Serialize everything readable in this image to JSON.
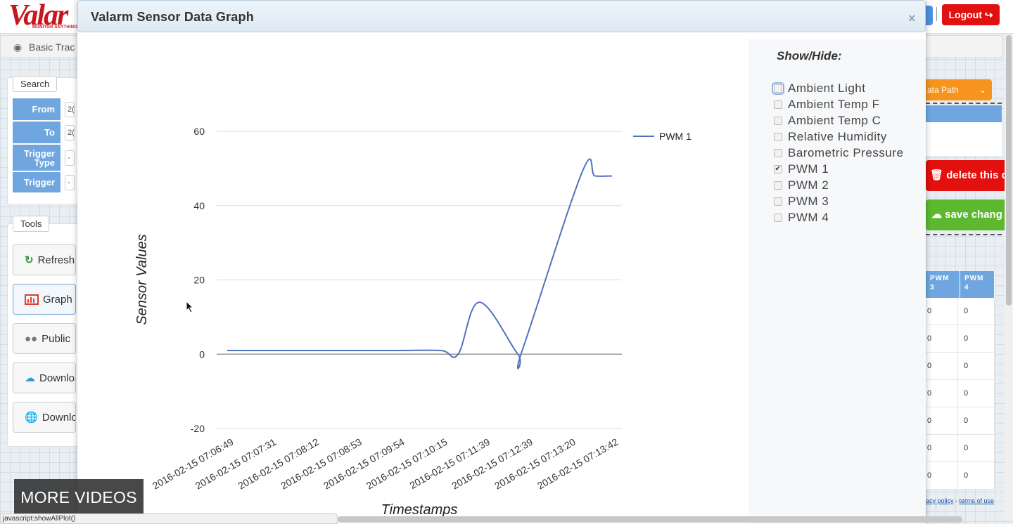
{
  "background": {
    "logo_text": "Valar",
    "logo_tagline": "MONITOR ANYTHING",
    "logout_label": "Logout",
    "breadcrumb": "Basic Trac",
    "search": {
      "legend": "Search",
      "rows": [
        {
          "label": "From",
          "value": "2("
        },
        {
          "label": "To",
          "value": "2("
        },
        {
          "label": "Trigger Type",
          "value": "-"
        },
        {
          "label": "Trigger",
          "value": "-"
        }
      ]
    },
    "tools": {
      "legend": "Tools",
      "buttons": [
        {
          "label": "Refresh",
          "icon": "refresh-icon"
        },
        {
          "label": "Graph",
          "icon": "bar-chart-icon"
        },
        {
          "label": "Public",
          "icon": "users-icon"
        },
        {
          "label": "Download",
          "icon": "cloud-download-icon"
        },
        {
          "label": "Download",
          "icon": "globe-icon"
        }
      ]
    },
    "right": {
      "data_path_label": "ata Path",
      "delete_label": "delete this de",
      "save_label": "save chang",
      "table": {
        "headers": [
          "PWM 3",
          "PWM 4"
        ],
        "rows": [
          [
            "0",
            "0"
          ],
          [
            "0",
            "0"
          ],
          [
            "0",
            "0"
          ],
          [
            "0",
            "0"
          ],
          [
            "0",
            "0"
          ],
          [
            "0",
            "0"
          ],
          [
            "0",
            "0"
          ]
        ]
      },
      "footer_privacy": "acy policy",
      "footer_sep": " - ",
      "footer_terms": "terms of use"
    }
  },
  "modal": {
    "title": "Valarm Sensor Data Graph",
    "close_label": "×",
    "show_hide": {
      "title": "Show/Hide:",
      "items": [
        {
          "label": "Ambient Light",
          "checked": false,
          "focused": true
        },
        {
          "label": "Ambient Temp F",
          "checked": false
        },
        {
          "label": "Ambient Temp C",
          "checked": false
        },
        {
          "label": "Relative Humidity",
          "checked": false
        },
        {
          "label": "Barometric Pressure",
          "checked": false
        },
        {
          "label": "PWM 1",
          "checked": true
        },
        {
          "label": "PWM 2",
          "checked": false
        },
        {
          "label": "PWM 3",
          "checked": false
        },
        {
          "label": "PWM 4",
          "checked": false
        }
      ]
    }
  },
  "chart_data": {
    "type": "line",
    "title": "",
    "xlabel": "Timestamps",
    "ylabel": "Sensor Values",
    "ylim": [
      -20,
      60
    ],
    "yticks": [
      -20,
      0,
      20,
      40,
      60
    ],
    "grid": true,
    "legend_position": "right",
    "x": [
      "2016-02-15 07:06:49",
      "2016-02-15 07:07:31",
      "2016-02-15 07:08:12",
      "2016-02-15 07:08:53",
      "2016-02-15 07:09:54",
      "2016-02-15 07:10:15",
      "2016-02-15 07:11:39",
      "2016-02-15 07:12:39",
      "2016-02-15 07:13:20",
      "2016-02-15 07:13:42"
    ],
    "series": [
      {
        "name": "PWM 1",
        "color": "#4f72c0",
        "values": [
          1,
          1,
          1,
          1,
          1,
          1,
          0,
          14,
          0,
          1,
          49,
          48,
          48
        ]
      }
    ],
    "series_x_positions": [
      0,
      1,
      2,
      3,
      4,
      5,
      5.4,
      5.9,
      6.8,
      6.9,
      8.3,
      8.6,
      9
    ]
  },
  "more_videos_label": "MORE VIDEOS",
  "status_text": "javascript:showAllPlot()"
}
